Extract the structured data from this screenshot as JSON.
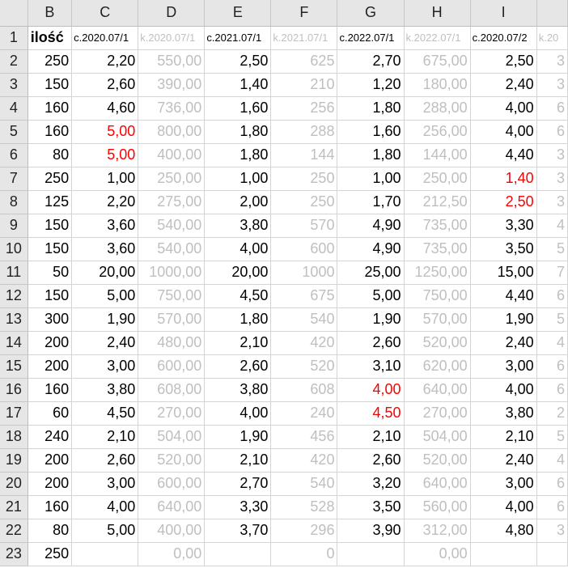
{
  "columns": [
    "B",
    "C",
    "D",
    "E",
    "F",
    "G",
    "H",
    "I",
    ""
  ],
  "header_row": {
    "row_number": "1",
    "cells": [
      "ilość",
      "c.2020.07/1",
      "k.2020.07/1",
      "c.2021.07/1",
      "k.2021.07/1",
      "c.2022.07/1",
      "k.2022.07/1",
      "c.2020.07/2",
      "k.20"
    ]
  },
  "rows": [
    {
      "n": "2",
      "cells": [
        "250",
        "2,20",
        "550,00",
        "2,50",
        "625",
        "2,70",
        "675,00",
        "2,50",
        "3"
      ]
    },
    {
      "n": "3",
      "cells": [
        "150",
        "2,60",
        "390,00",
        "1,40",
        "210",
        "1,20",
        "180,00",
        "2,40",
        "3"
      ]
    },
    {
      "n": "4",
      "cells": [
        "160",
        "4,60",
        "736,00",
        "1,60",
        "256",
        "1,80",
        "288,00",
        "4,00",
        "6"
      ]
    },
    {
      "n": "5",
      "cells": [
        "160",
        "5,00",
        "800,00",
        "1,80",
        "288",
        "1,60",
        "256,00",
        "4,00",
        "6"
      ]
    },
    {
      "n": "6",
      "cells": [
        "80",
        "5,00",
        "400,00",
        "1,80",
        "144",
        "1,80",
        "144,00",
        "4,40",
        "3"
      ]
    },
    {
      "n": "7",
      "cells": [
        "250",
        "1,00",
        "250,00",
        "1,00",
        "250",
        "1,00",
        "250,00",
        "1,40",
        "3"
      ]
    },
    {
      "n": "8",
      "cells": [
        "125",
        "2,20",
        "275,00",
        "2,00",
        "250",
        "1,70",
        "212,50",
        "2,50",
        "3"
      ]
    },
    {
      "n": "9",
      "cells": [
        "150",
        "3,60",
        "540,00",
        "3,80",
        "570",
        "4,90",
        "735,00",
        "3,30",
        "4"
      ]
    },
    {
      "n": "10",
      "cells": [
        "150",
        "3,60",
        "540,00",
        "4,00",
        "600",
        "4,90",
        "735,00",
        "3,50",
        "5"
      ]
    },
    {
      "n": "11",
      "cells": [
        "50",
        "20,00",
        "1000,00",
        "20,00",
        "1000",
        "25,00",
        "1250,00",
        "15,00",
        "7"
      ]
    },
    {
      "n": "12",
      "cells": [
        "150",
        "5,00",
        "750,00",
        "4,50",
        "675",
        "5,00",
        "750,00",
        "4,40",
        "6"
      ]
    },
    {
      "n": "13",
      "cells": [
        "300",
        "1,90",
        "570,00",
        "1,80",
        "540",
        "1,90",
        "570,00",
        "1,90",
        "5"
      ]
    },
    {
      "n": "14",
      "cells": [
        "200",
        "2,40",
        "480,00",
        "2,10",
        "420",
        "2,60",
        "520,00",
        "2,40",
        "4"
      ]
    },
    {
      "n": "15",
      "cells": [
        "200",
        "3,00",
        "600,00",
        "2,60",
        "520",
        "3,10",
        "620,00",
        "3,00",
        "6"
      ]
    },
    {
      "n": "16",
      "cells": [
        "160",
        "3,80",
        "608,00",
        "3,80",
        "608",
        "4,00",
        "640,00",
        "4,00",
        "6"
      ]
    },
    {
      "n": "17",
      "cells": [
        "60",
        "4,50",
        "270,00",
        "4,00",
        "240",
        "4,50",
        "270,00",
        "3,80",
        "2"
      ]
    },
    {
      "n": "18",
      "cells": [
        "240",
        "2,10",
        "504,00",
        "1,90",
        "456",
        "2,10",
        "504,00",
        "2,10",
        "5"
      ]
    },
    {
      "n": "19",
      "cells": [
        "200",
        "2,60",
        "520,00",
        "2,10",
        "420",
        "2,60",
        "520,00",
        "2,40",
        "4"
      ]
    },
    {
      "n": "20",
      "cells": [
        "200",
        "3,00",
        "600,00",
        "2,70",
        "540",
        "3,20",
        "640,00",
        "3,00",
        "6"
      ]
    },
    {
      "n": "21",
      "cells": [
        "160",
        "4,00",
        "640,00",
        "3,30",
        "528",
        "3,50",
        "560,00",
        "4,00",
        "6"
      ]
    },
    {
      "n": "22",
      "cells": [
        "80",
        "5,00",
        "400,00",
        "3,70",
        "296",
        "3,90",
        "312,00",
        "4,80",
        "3"
      ]
    },
    {
      "n": "23",
      "cells": [
        "250",
        "",
        "0,00",
        "",
        "0",
        "",
        "0,00",
        "",
        ""
      ]
    }
  ],
  "styles": {
    "grey_columns": [
      2,
      4,
      6,
      8
    ],
    "red_cells": [
      [
        5,
        1
      ],
      [
        6,
        1
      ],
      [
        7,
        7
      ],
      [
        8,
        7
      ],
      [
        16,
        5
      ],
      [
        17,
        5
      ]
    ],
    "colors": {
      "grey_text": "#bfbfbf",
      "red_text": "#ff0000",
      "header_bg": "#e6e6e6",
      "grid": "#d4d4d4"
    }
  }
}
